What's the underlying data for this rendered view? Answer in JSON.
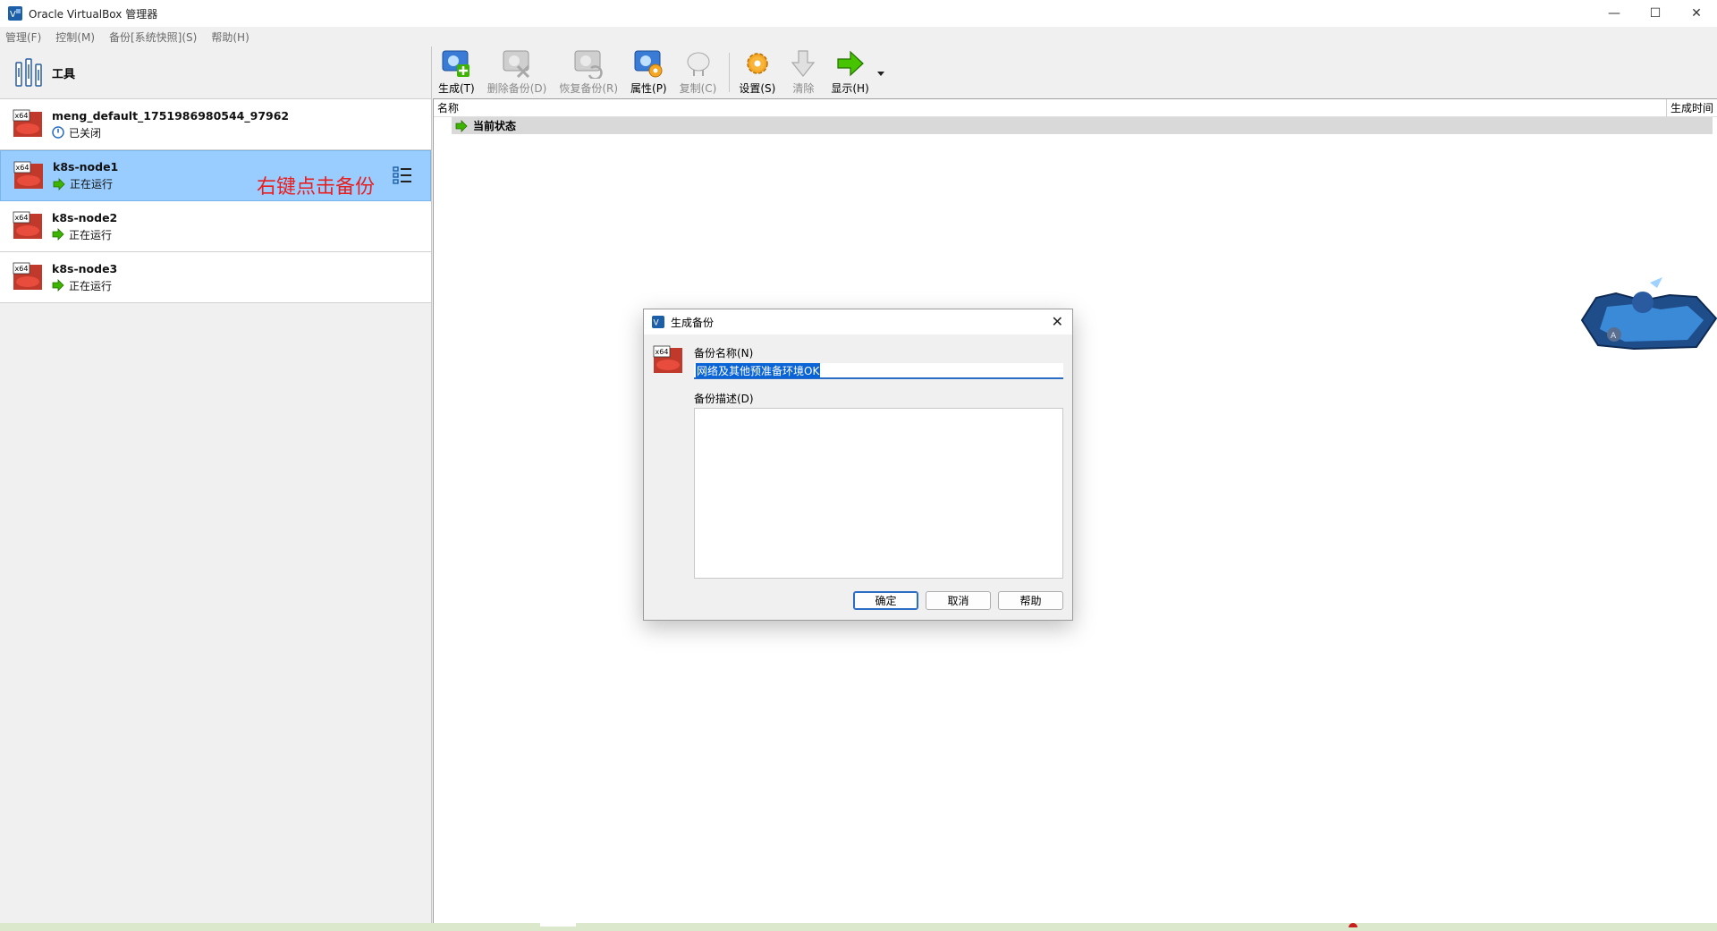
{
  "window": {
    "title": "Oracle VirtualBox 管理器",
    "controls": {
      "minimize": "—",
      "maximize": "☐",
      "close": "✕"
    }
  },
  "menu": [
    "管理(F)",
    "控制(M)",
    "备份[系统快照](S)",
    "帮助(H)"
  ],
  "tools": {
    "label": "工具"
  },
  "vms": [
    {
      "name": "meng_default_1751986980544_97962",
      "state": "已关闭",
      "state_type": "off"
    },
    {
      "name": "k8s-node1",
      "state": "正在运行",
      "state_type": "running",
      "selected": true
    },
    {
      "name": "k8s-node2",
      "state": "正在运行",
      "state_type": "running"
    },
    {
      "name": "k8s-node3",
      "state": "正在运行",
      "state_type": "running"
    }
  ],
  "annotation": "右键点击备份",
  "toolbar": {
    "take": "生成(T)",
    "delete": "删除备份(D)",
    "restore": "恢复备份(R)",
    "properties": "属性(P)",
    "clone": "复制(C)",
    "settings": "设置(S)",
    "discard": "清除",
    "show": "显示(H)"
  },
  "snapshots": {
    "col_name": "名称",
    "col_time": "生成时间",
    "current": "当前状态"
  },
  "dialog": {
    "title": "生成备份",
    "name_label": "备份名称(N)",
    "name_value": "网络及其他预准备环境OK",
    "desc_label": "备份描述(D)",
    "desc_value": "",
    "ok": "确定",
    "cancel": "取消",
    "help": "帮助"
  },
  "colors": {
    "selection": "#99ccff",
    "accent": "#2b6cc4",
    "annotation": "#e81f1f",
    "running": "#3cb400"
  }
}
